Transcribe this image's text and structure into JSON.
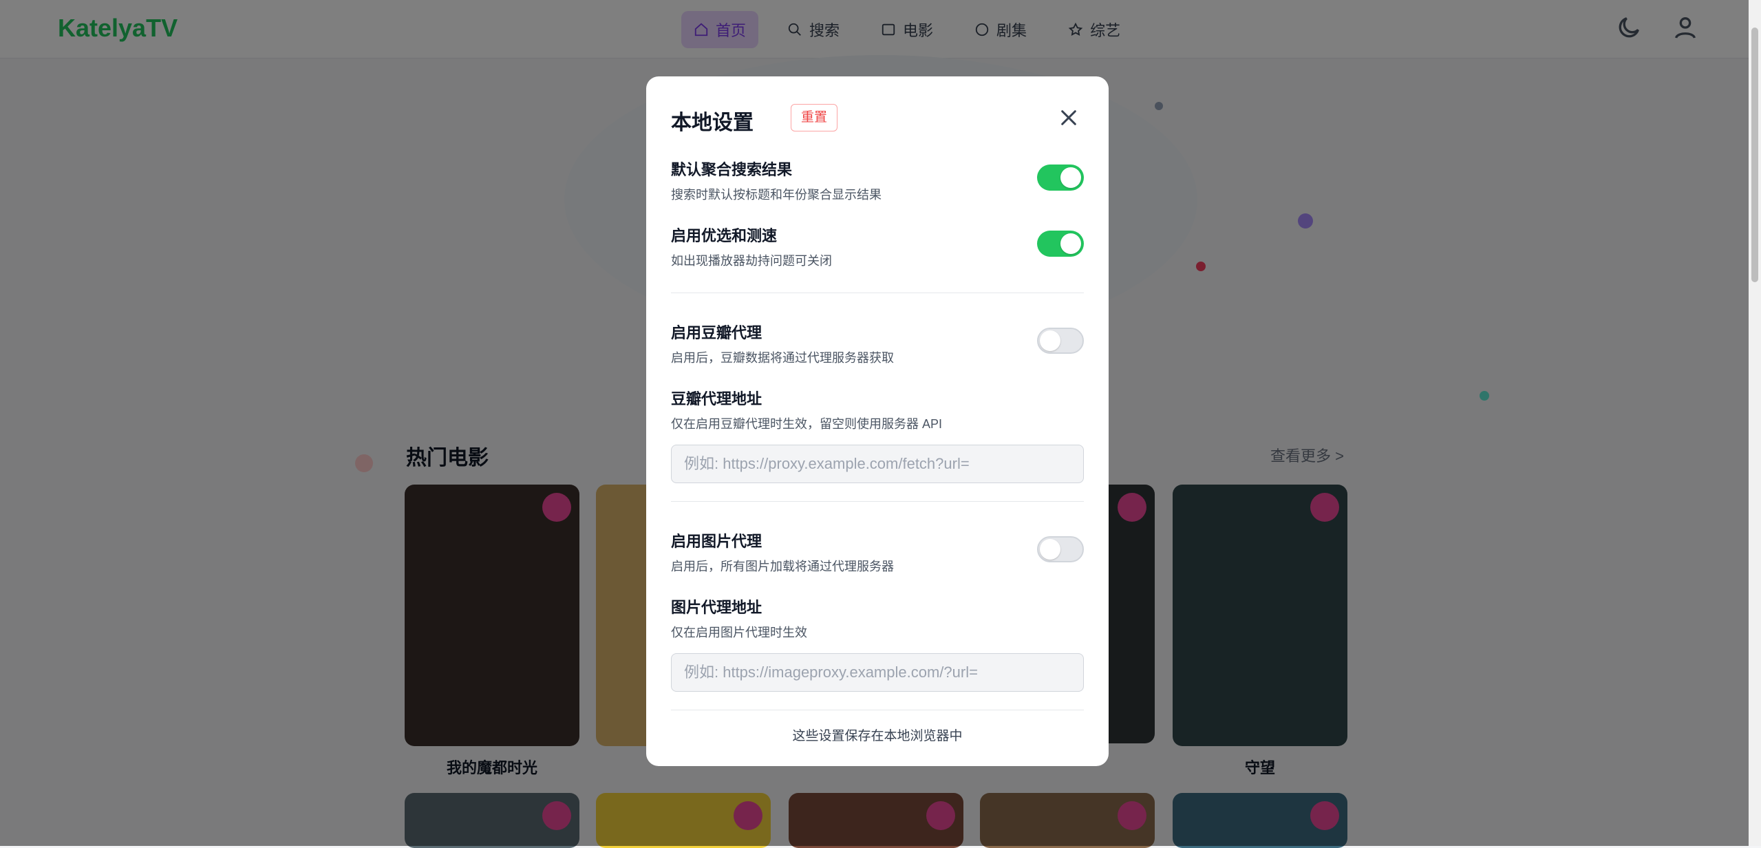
{
  "app": {
    "logo": "KatelyaTV"
  },
  "nav": [
    {
      "label": "首页",
      "icon": "home-icon",
      "active": true
    },
    {
      "label": "搜索",
      "icon": "search-icon",
      "active": false
    },
    {
      "label": "电影",
      "icon": "film-icon",
      "active": false
    },
    {
      "label": "剧集",
      "icon": "tv-icon",
      "active": false
    },
    {
      "label": "综艺",
      "icon": "star-icon",
      "active": false
    }
  ],
  "section": {
    "title": "热门电影",
    "more": "查看更多 >"
  },
  "movies": [
    {
      "title": "我的魔都时光"
    },
    {
      "title": ""
    },
    {
      "title": ""
    },
    {
      "title": ""
    },
    {
      "title": "守望"
    }
  ],
  "modal": {
    "title": "本地设置",
    "reset_label": "重置",
    "settings": {
      "aggregate": {
        "label": "默认聚合搜索结果",
        "desc": "搜索时默认按标题和年份聚合显示结果",
        "enabled": true
      },
      "optimize": {
        "label": "启用优选和测速",
        "desc": "如出现播放器劫持问题可关闭",
        "enabled": true
      },
      "douban_proxy": {
        "label": "启用豆瓣代理",
        "desc": "启用后，豆瓣数据将通过代理服务器获取",
        "enabled": false
      },
      "douban_url": {
        "label": "豆瓣代理地址",
        "desc": "仅在启用豆瓣代理时生效，留空则使用服务器 API",
        "placeholder": "例如: https://proxy.example.com/fetch?url="
      },
      "image_proxy": {
        "label": "启用图片代理",
        "desc": "启用后，所有图片加载将通过代理服务器",
        "enabled": false
      },
      "image_url": {
        "label": "图片代理地址",
        "desc": "仅在启用图片代理时生效",
        "placeholder": "例如: https://imageproxy.example.com/?url="
      }
    },
    "footer": "这些设置保存在本地浏览器中"
  },
  "colors": {
    "accent": "#22c55e",
    "danger": "#ef4444",
    "nav_active": "#7c3aed"
  }
}
